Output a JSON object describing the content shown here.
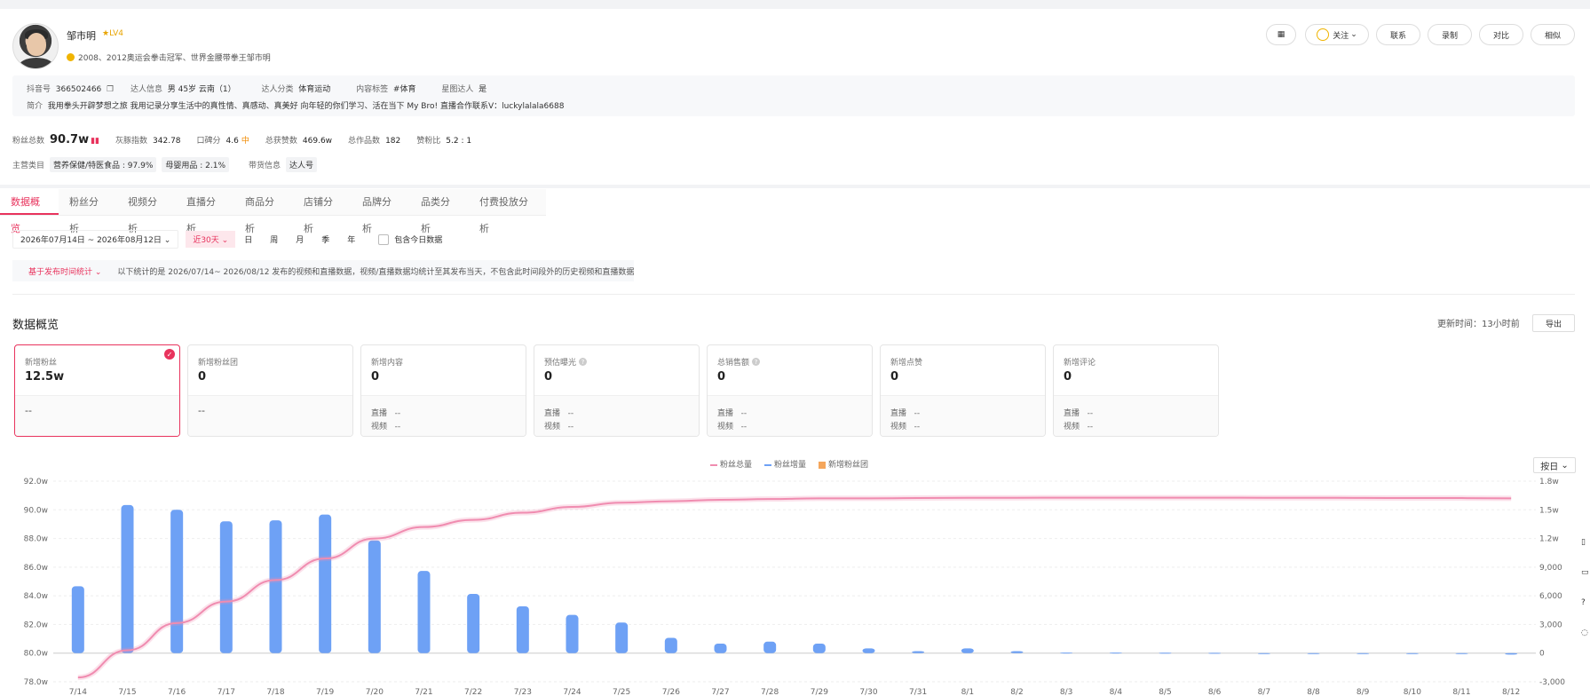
{
  "profile": {
    "name": "邹市明",
    "level": "LV4",
    "honor": "2008、2012奥运会拳击冠军、世界金腰带拳王邹市明",
    "douyin_label": "抖音号",
    "douyin_id": "366502466",
    "info_label": "达人信息",
    "info_value": "男 45岁 云南（1）",
    "category_label": "达人分类",
    "category_value": "体育运动",
    "content_tag_label": "内容标签",
    "content_tag_value": "#体育",
    "star_label": "星图达人",
    "star_value": "是",
    "intro_label": "简介",
    "intro_value": "我用拳头开辟梦想之旅 我用记录分享生活中的真性情、真感动、真美好 向年轻的你们学习、活在当下 My Bro! 直播合作联系V：luckylalala6688"
  },
  "buttons": {
    "qr": "▦",
    "follow": "关注",
    "contact": "联系",
    "record": "录制",
    "compare": "对比",
    "similar": "相似"
  },
  "stats": {
    "fans_label": "粉丝总数",
    "fans_value": "90.7w",
    "grey_label": "灰豚指数",
    "grey_value": "342.78",
    "rep_label": "口碑分",
    "rep_value": "4.6",
    "rep_grade": "中",
    "likes_label": "总获赞数",
    "likes_value": "469.6w",
    "works_label": "总作品数",
    "works_value": "182",
    "ratio_label": "赞粉比",
    "ratio_value": "5.2 : 1"
  },
  "categories": {
    "label": "主营类目",
    "items": [
      "营养保健/特医食品 : 97.9%",
      "母婴用品 : 2.1%"
    ],
    "goods_label": "带货信息",
    "goods_value": "达人号"
  },
  "tabs": [
    "数据概览",
    "粉丝分析",
    "视频分析",
    "直播分析",
    "商品分析",
    "店铺分析",
    "品牌分析",
    "品类分析",
    "付费投放分析"
  ],
  "filters": {
    "date_range": "2026年07月14日 ~ 2026年08月12日",
    "recent": "近30天",
    "periods": [
      "日",
      "周",
      "月",
      "季",
      "年"
    ],
    "include_today": "包含今日数据"
  },
  "notice": {
    "stat_by": "基于发布时间统计",
    "text": "以下统计的是 2026/07/14~ 2026/08/12 发布的视频和直播数据，视频/直播数据均统计至其发布当天，不包含此时间段外的历史视频和直播数据"
  },
  "overview": {
    "title": "数据概览",
    "updated": "更新时间：13小时前",
    "export": "导出"
  },
  "kpis": [
    {
      "label": "新增粉丝",
      "value": "12.5w",
      "bottom": "--",
      "selected": true
    },
    {
      "label": "新增粉丝团",
      "value": "0",
      "bottom": "--"
    },
    {
      "label": "新增内容",
      "value": "0",
      "live": "直播",
      "live_v": "--",
      "video": "视频",
      "video_v": "--"
    },
    {
      "label": "预估曝光",
      "value": "0",
      "live": "直播",
      "live_v": "--",
      "video": "视频",
      "video_v": "--",
      "help": true
    },
    {
      "label": "总销售额",
      "value": "0",
      "live": "直播",
      "live_v": "--",
      "video": "视频",
      "video_v": "--",
      "help": true
    },
    {
      "label": "新增点赞",
      "value": "0",
      "live": "直播",
      "live_v": "--",
      "video": "视频",
      "video_v": "--"
    },
    {
      "label": "新增评论",
      "value": "0",
      "live": "直播",
      "live_v": "--",
      "video": "视频",
      "video_v": "--"
    }
  ],
  "chart_controls": {
    "by_day": "按日"
  },
  "chart_data": {
    "type": "bar",
    "legend": [
      "粉丝总量",
      "粉丝增量",
      "新增粉丝团"
    ],
    "colors": {
      "total": "#f08cb0",
      "increment": "#6ea1f5",
      "fan_group": "#f5a65b"
    },
    "categories": [
      "7/14",
      "7/15",
      "7/16",
      "7/17",
      "7/18",
      "7/19",
      "7/20",
      "7/21",
      "7/22",
      "7/23",
      "7/24",
      "7/25",
      "7/26",
      "7/27",
      "7/28",
      "7/29",
      "7/30",
      "7/31",
      "8/1",
      "8/2",
      "8/3",
      "8/4",
      "8/5",
      "8/6",
      "8/7",
      "8/8",
      "8/9",
      "8/10",
      "8/11",
      "8/12"
    ],
    "left_axis": {
      "ticks": [
        "78.0w",
        "80.0w",
        "82.0w",
        "84.0w",
        "86.0w",
        "88.0w",
        "90.0w",
        "92.0w"
      ],
      "min": 78,
      "max": 92
    },
    "right_axis": {
      "ticks": [
        "-3,000",
        "0",
        "3,000",
        "6,000",
        "9,000",
        "1.2w",
        "1.5w",
        "1.8w"
      ],
      "min": -3000,
      "max": 18000
    },
    "series": [
      {
        "name": "粉丝增量",
        "axis": "right",
        "values": [
          7000,
          15500,
          15000,
          13800,
          13900,
          14500,
          11800,
          8600,
          6200,
          4900,
          4000,
          3200,
          1600,
          1000,
          1200,
          1000,
          500,
          200,
          500,
          200,
          60,
          60,
          40,
          30,
          -90,
          -60,
          -60,
          -60,
          -60,
          -150
        ]
      },
      {
        "name": "粉丝总量",
        "axis": "left",
        "values": [
          78.3,
          80.2,
          82.1,
          83.6,
          85.1,
          86.6,
          88.0,
          88.8,
          89.3,
          89.8,
          90.2,
          90.5,
          90.6,
          90.7,
          90.75,
          90.8,
          90.8,
          90.82,
          90.84,
          90.84,
          90.85,
          90.85,
          90.85,
          90.85,
          90.84,
          90.84,
          90.83,
          90.82,
          90.82,
          90.8
        ]
      }
    ]
  }
}
